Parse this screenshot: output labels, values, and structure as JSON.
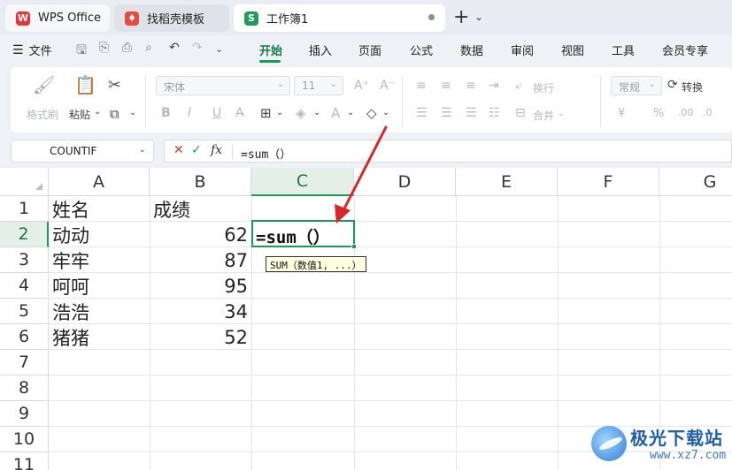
{
  "tabs": [
    {
      "label": "WPS Office",
      "icon": "wps-logo-icon"
    },
    {
      "label": "找稻壳模板",
      "icon": "docer-icon"
    },
    {
      "label": "工作簿1",
      "icon": "spreadsheet-icon",
      "icon_letter": "S",
      "active": true
    }
  ],
  "menu": {
    "file": "文件",
    "items": [
      "开始",
      "插入",
      "页面",
      "公式",
      "数据",
      "审阅",
      "视图",
      "工具",
      "会员专享"
    ],
    "active": "开始"
  },
  "ribbon": {
    "format_painter": "格式刷",
    "paste": "粘贴",
    "font_name": "宋体",
    "font_size": "11",
    "wrap": "换行",
    "merge": "合并",
    "number_format": "常规",
    "convert": "转换",
    "bold": "B",
    "italic": "I",
    "underline": "U",
    "currency": "¥",
    "percent": "%"
  },
  "formula_bar": {
    "name_box": "COUNTIF",
    "fx": "fx",
    "formula": "=sum（）"
  },
  "grid": {
    "columns": [
      "A",
      "B",
      "C",
      "D",
      "E",
      "F",
      "G"
    ],
    "selected_column": "C",
    "rows": [
      "1",
      "2",
      "3",
      "4",
      "5",
      "6",
      "7",
      "8",
      "9",
      "10",
      "11"
    ],
    "selected_row": "2",
    "headers": {
      "A": "姓名",
      "B": "成绩"
    },
    "records": [
      {
        "name": "动动",
        "score": "62"
      },
      {
        "name": "牢牢",
        "score": "87"
      },
      {
        "name": "呵呵",
        "score": "95"
      },
      {
        "name": "浩浩",
        "score": "34"
      },
      {
        "name": "猪猪",
        "score": "52"
      }
    ],
    "active_cell_text": "=sum（）",
    "tooltip": "SUM（数值1, ...）"
  },
  "watermark": {
    "title": "极光下载站",
    "url": "www.xz7.com"
  },
  "colors": {
    "accent": "#1a9b57",
    "arrow": "#d9262b"
  }
}
